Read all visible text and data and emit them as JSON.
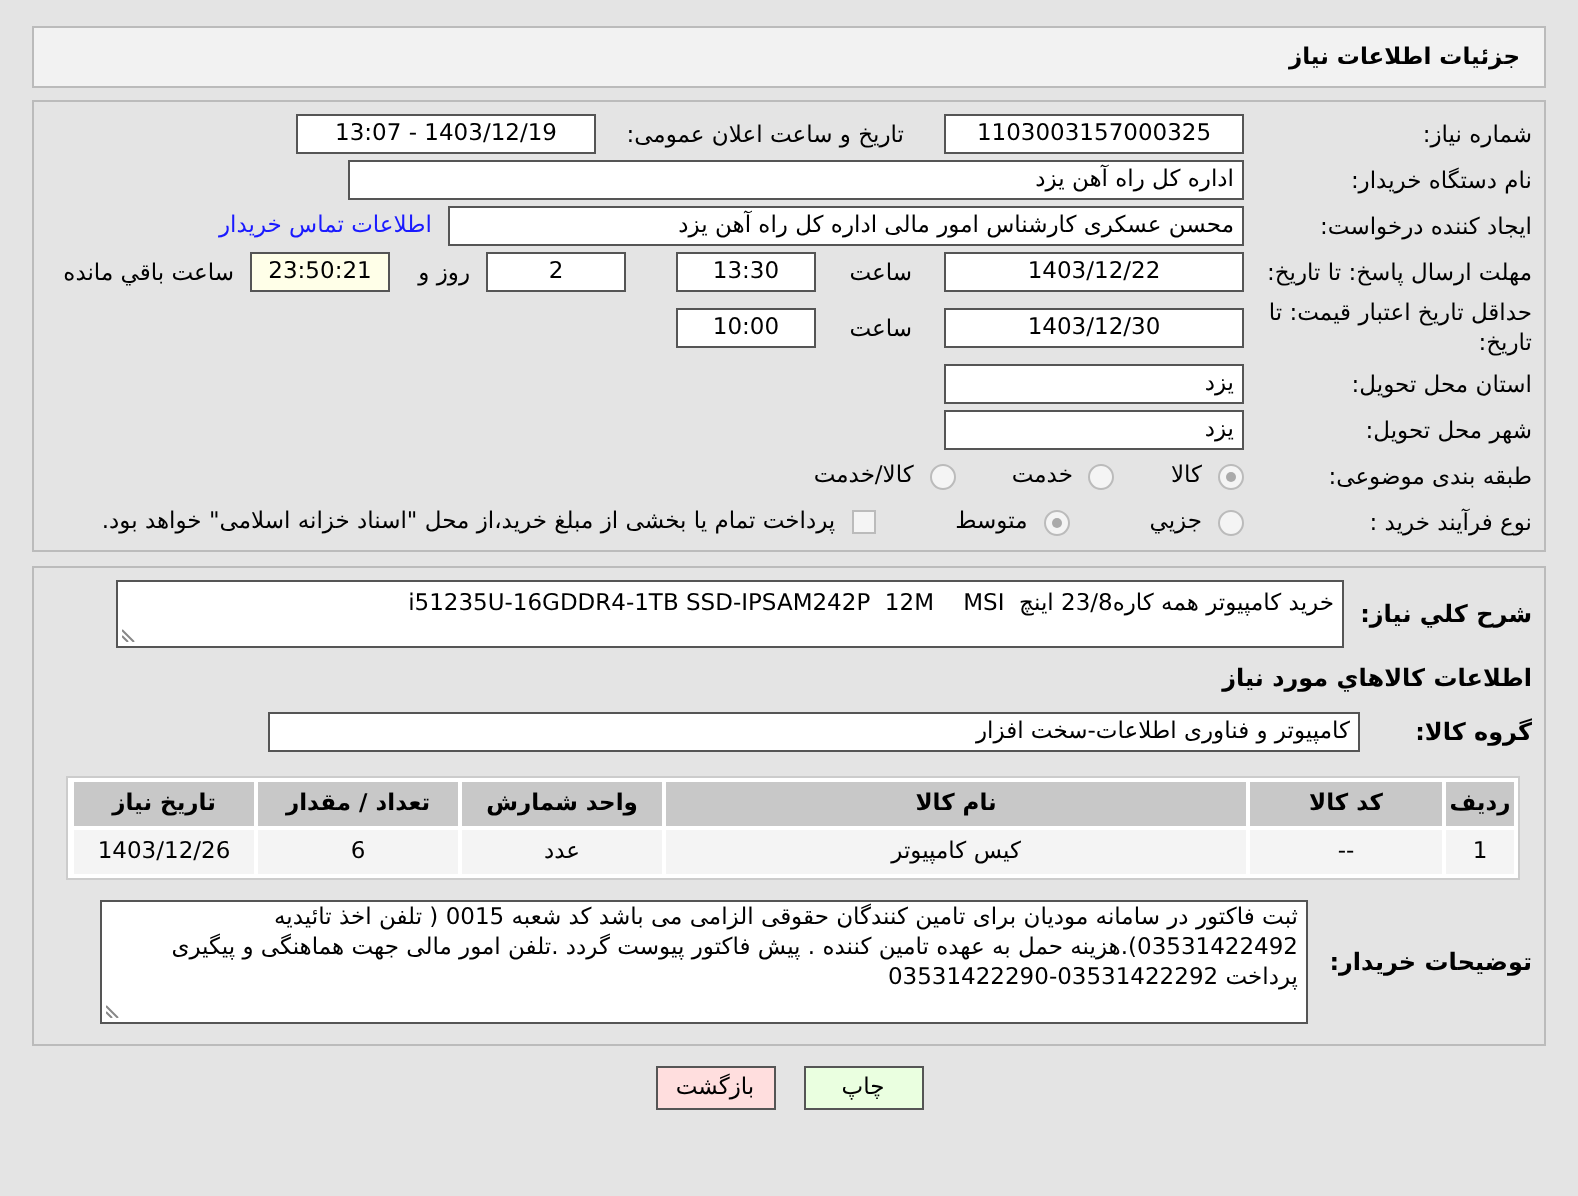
{
  "header": {
    "title": "جزئیات اطلاعات نیاز"
  },
  "need_number": {
    "label": "شماره نیاز:",
    "value": "1103003157000325"
  },
  "announce": {
    "label": "تاریخ و ساعت اعلان عمومی:",
    "value": "1403/12/19 - 13:07"
  },
  "buyer": {
    "label": "نام دستگاه خریدار:",
    "value": "اداره کل راه آهن یزد"
  },
  "creator": {
    "label": "ایجاد کننده درخواست:",
    "value": "محسن عسکری کارشناس امور مالی اداره کل راه آهن یزد",
    "link": "اطلاعات تماس خریدار"
  },
  "deadline": {
    "label": "مهلت ارسال پاسخ: تا تاریخ:",
    "date": "1403/12/22",
    "time_label": "ساعت",
    "time": "13:30",
    "days": "2",
    "days_label": "روز و",
    "remaining": "23:50:21",
    "remaining_label": "ساعت باقي مانده"
  },
  "validity": {
    "label": "حداقل تاریخ اعتبار قیمت: تا تاریخ:",
    "date": "1403/12/30",
    "time_label": "ساعت",
    "time": "10:00"
  },
  "province": {
    "label": "استان محل تحویل:",
    "value": "یزد"
  },
  "city": {
    "label": "شهر محل تحویل:",
    "value": "یزد"
  },
  "category": {
    "label": "طبقه بندی موضوعی:",
    "options": [
      {
        "label": "کالا",
        "selected": true
      },
      {
        "label": "خدمت",
        "selected": false
      },
      {
        "label": "کالا/خدمت",
        "selected": false
      }
    ]
  },
  "process": {
    "label": "نوع فرآیند خرید :",
    "options": [
      {
        "label": "جزیي",
        "selected": false
      },
      {
        "label": "متوسط",
        "selected": true
      }
    ],
    "payment": {
      "label": "پرداخت تمام یا بخشی از مبلغ خرید،از محل \"اسناد خزانه اسلامی\" خواهد بود.",
      "checked": false
    }
  },
  "description": {
    "label": "شرح کلي نياز:",
    "value": "خرید کامپیوتر همه کاره23/8 اینچ  i51235U-16GDDR4-1TB SSD-IPSAM242P  12M    MSI"
  },
  "goods_heading": "اطلاعات كالاهاي مورد نياز",
  "goods_group": {
    "label": "گروه کالا:",
    "value": "کامپیوتر و فناوری اطلاعات-سخت افزار"
  },
  "table": {
    "columns": [
      "ردیف",
      "کد کالا",
      "نام کالا",
      "واحد شمارش",
      "تعداد / مقدار",
      "تاریخ نیاز"
    ],
    "rows": [
      [
        "1",
        "--",
        "کیس کامپیوتر",
        "عدد",
        "6",
        "1403/12/26"
      ]
    ]
  },
  "notes": {
    "label": "توضیحات خریدار:",
    "value": "ثبت فاکتور در سامانه مودیان برای تامین کنندگان حقوقی الزامی می باشد کد شعبه 0015 ( تلفن اخذ تائیدیه 03531422492).هزینه حمل به عهده تامین کننده . پیش فاکتور پیوست گردد .تلفن امور مالی جهت هماهنگی و پیگیری پرداخت 03531422292-03531422290"
  },
  "buttons": [
    {
      "label": "چاپ",
      "kind": "print"
    },
    {
      "label": "بازگشت",
      "kind": "back"
    }
  ]
}
